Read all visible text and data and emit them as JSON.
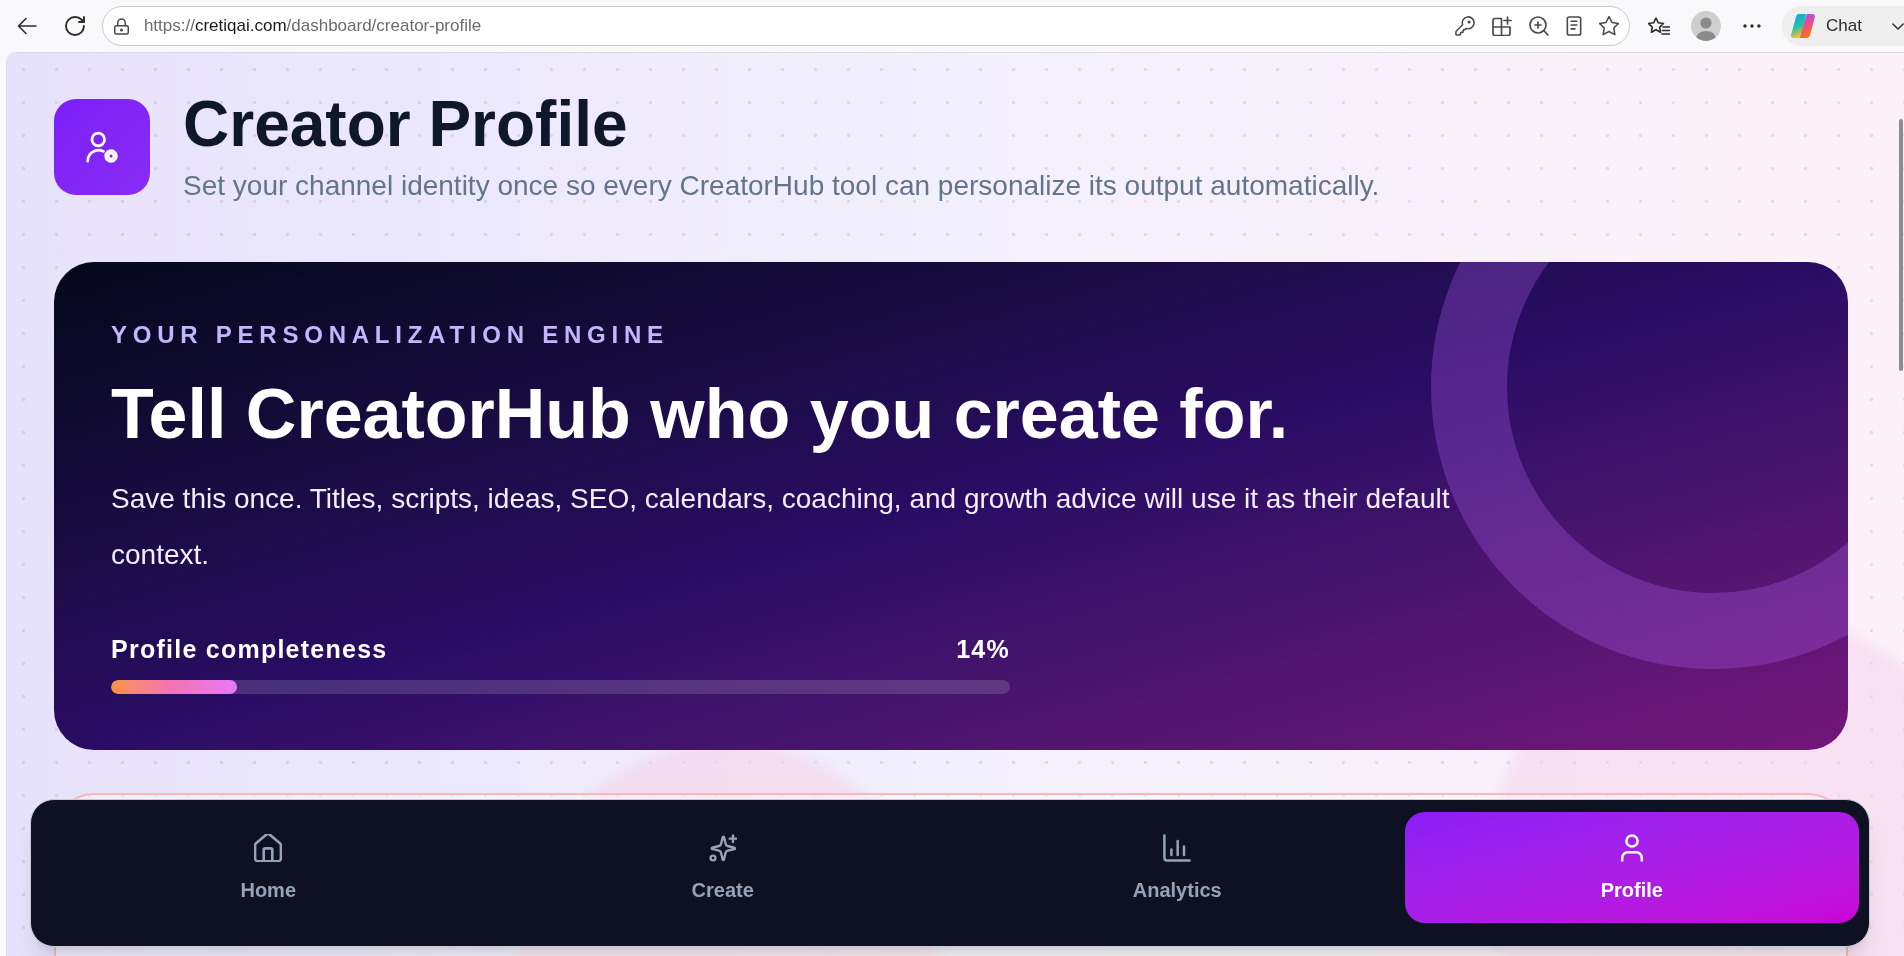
{
  "browser": {
    "url": {
      "scheme": "https://",
      "host": "cretiqai.com",
      "path": "/dashboard/creator-profile"
    },
    "chat_button": "Chat"
  },
  "header": {
    "title": "Creator Profile",
    "subtitle": "Set your channel identity once so every CreatorHub tool can personalize its output automatically."
  },
  "hero": {
    "eyebrow": "YOUR PERSONALIZATION ENGINE",
    "headline": "Tell CreatorHub who you create for.",
    "description": "Save this once. Titles, scripts, ideas, SEO, calendars, coaching, and growth advice will use it as their default context.",
    "progress": {
      "label": "Profile completeness",
      "reading": "14%",
      "level": 0.14
    }
  },
  "bottom_nav": [
    {
      "kind": "home",
      "label": "Home",
      "selected": false
    },
    {
      "kind": "create",
      "label": "Create",
      "selected": false
    },
    {
      "kind": "analytics",
      "label": "Analytics",
      "selected": false
    },
    {
      "kind": "profile",
      "label": "Profile",
      "selected": true
    }
  ]
}
